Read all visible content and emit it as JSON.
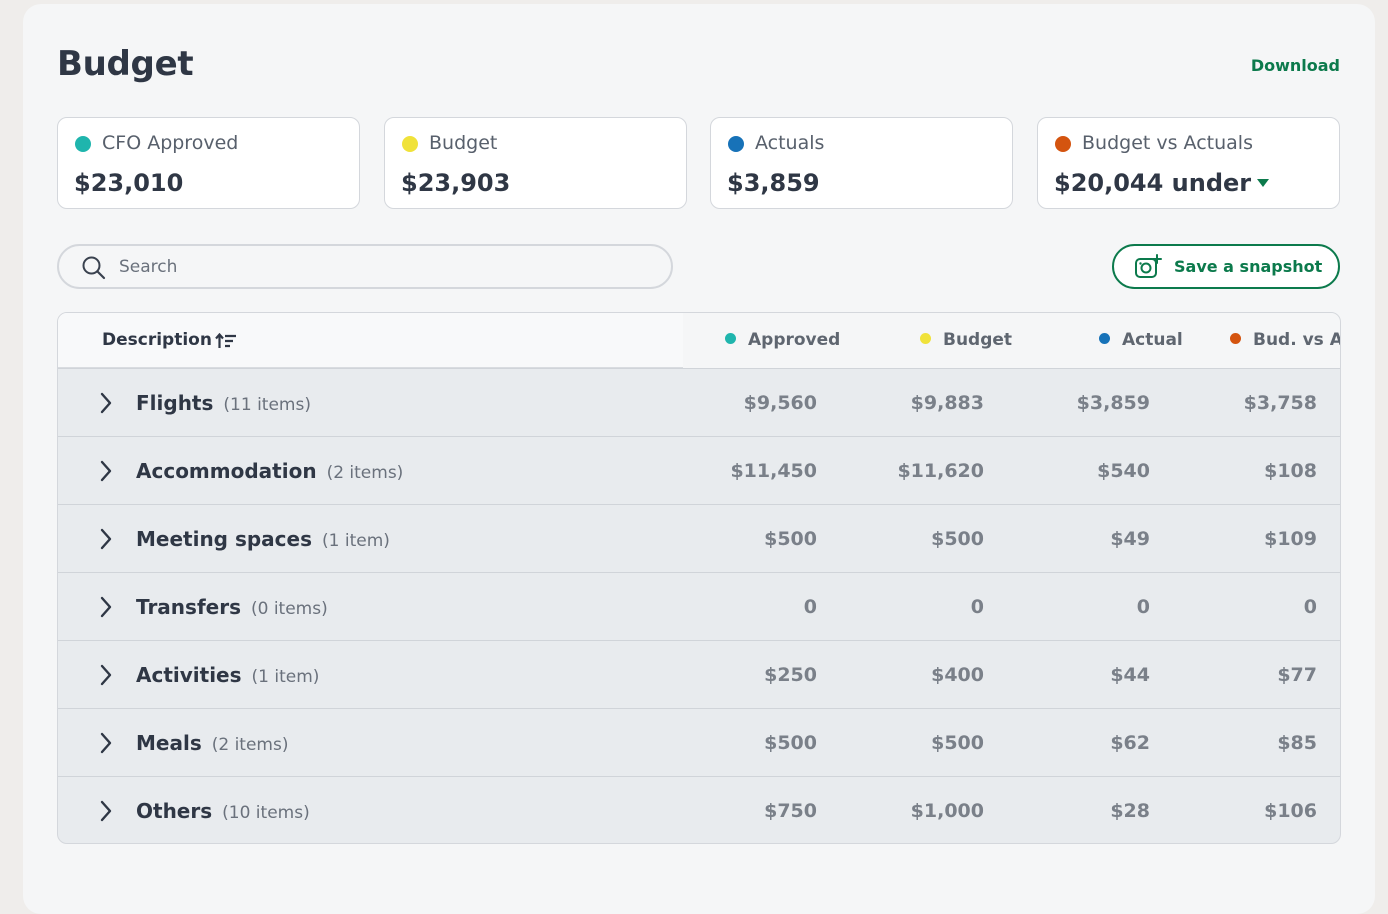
{
  "header": {
    "title": "Budget",
    "download_label": "Download"
  },
  "colors": {
    "approved": "#1fb5ad",
    "budget": "#f0e23a",
    "actual": "#1772b8",
    "variance": "#d4540f",
    "accent": "#0c7a4c"
  },
  "cards": [
    {
      "label": "CFO Approved",
      "value": "$23,010",
      "color": "#1fb5ad"
    },
    {
      "label": "Budget",
      "value": "$23,903",
      "color": "#f0e23a"
    },
    {
      "label": "Actuals",
      "value": "$3,859",
      "color": "#1772b8"
    },
    {
      "label": "Budget vs Actuals",
      "value": "$20,044 under",
      "color": "#d4540f",
      "icon": "caret-down-icon"
    }
  ],
  "search": {
    "placeholder": "Search",
    "value": ""
  },
  "snapshot_button": {
    "label": "Save a snapshot",
    "icon": "camera-plus-icon"
  },
  "table": {
    "description_header": "Description",
    "columns": [
      {
        "label": "Approved",
        "color": "#1fb5ad"
      },
      {
        "label": "Budget",
        "color": "#f0e23a"
      },
      {
        "label": "Actual",
        "color": "#1772b8"
      },
      {
        "label": "Bud. vs Ac",
        "color": "#d4540f"
      }
    ],
    "rows": [
      {
        "name": "Flights",
        "count": "(11 items)",
        "approved": "$9,560",
        "budget": "$9,883",
        "actual": "$3,859",
        "variance": "$3,758"
      },
      {
        "name": "Accommodation",
        "count": "(2 items)",
        "approved": "$11,450",
        "budget": "$11,620",
        "actual": "$540",
        "variance": "$108"
      },
      {
        "name": "Meeting spaces",
        "count": "(1 item)",
        "approved": "$500",
        "budget": "$500",
        "actual": "$49",
        "variance": "$109"
      },
      {
        "name": "Transfers",
        "count": "(0 items)",
        "approved": "0",
        "budget": "0",
        "actual": "0",
        "variance": "0"
      },
      {
        "name": "Activities",
        "count": "(1 item)",
        "approved": "$250",
        "budget": "$400",
        "actual": "$44",
        "variance": "$77"
      },
      {
        "name": "Meals",
        "count": "(2 items)",
        "approved": "$500",
        "budget": "$500",
        "actual": "$62",
        "variance": "$85"
      },
      {
        "name": "Others",
        "count": "(10 items)",
        "approved": "$750",
        "budget": "$1,000",
        "actual": "$28",
        "variance": "$106"
      }
    ]
  }
}
